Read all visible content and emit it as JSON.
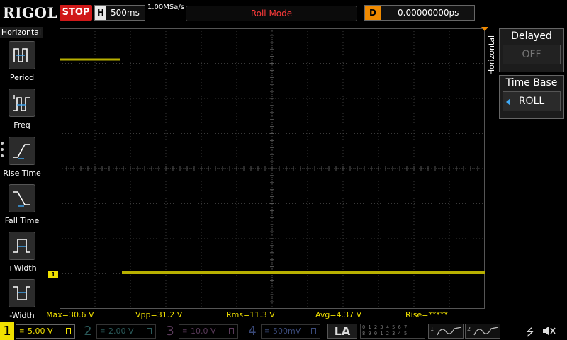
{
  "topbar": {
    "brand": "RIGOL",
    "run_state": "STOP",
    "horizontal_letter": "H",
    "timebase": "500ms",
    "sample_rate": "1.00MSa/s",
    "mode": "Roll Mode",
    "delay_letter": "D",
    "delay": "0.00000000ps"
  },
  "left_menu": {
    "title": "Horizontal",
    "items": [
      {
        "label": "Period",
        "icon": "period-icon"
      },
      {
        "label": "Freq",
        "icon": "freq-icon"
      },
      {
        "label": "Rise Time",
        "icon": "rise-time-icon"
      },
      {
        "label": "Fall Time",
        "icon": "fall-time-icon"
      },
      {
        "label": "+Width",
        "icon": "positive-width-icon"
      },
      {
        "label": "-Width",
        "icon": "negative-width-icon"
      }
    ]
  },
  "right_menu": {
    "tab": "Horizontal",
    "delayed": {
      "title": "Delayed",
      "value": "OFF"
    },
    "time_base": {
      "title": "Time Base",
      "value": "ROLL"
    }
  },
  "screen": {
    "ch1_marker": "1"
  },
  "measurements": [
    {
      "label": "Max=30.6 V"
    },
    {
      "label": "Vpp=31.2 V"
    },
    {
      "label": "Rms=11.3 V"
    },
    {
      "label": "Avg=4.37 V"
    },
    {
      "label": "Rise=*****"
    }
  ],
  "channels": [
    {
      "num": "1",
      "scale": "5.00 V"
    },
    {
      "num": "2",
      "scale": "2.00 V"
    },
    {
      "num": "3",
      "scale": "10.0 V"
    },
    {
      "num": "4",
      "scale": "500mV"
    }
  ],
  "la_label": "LA",
  "la_digits_row1": "0 1 2 3  4 5 6 7",
  "la_digits_row2": "8 9 0 1  2 3 4 5",
  "generators": [
    "1",
    "2"
  ],
  "colors": {
    "ch1": "#f0e000",
    "trace": "#b8b000",
    "stop": "#d01818",
    "delay": "#f08a00"
  }
}
